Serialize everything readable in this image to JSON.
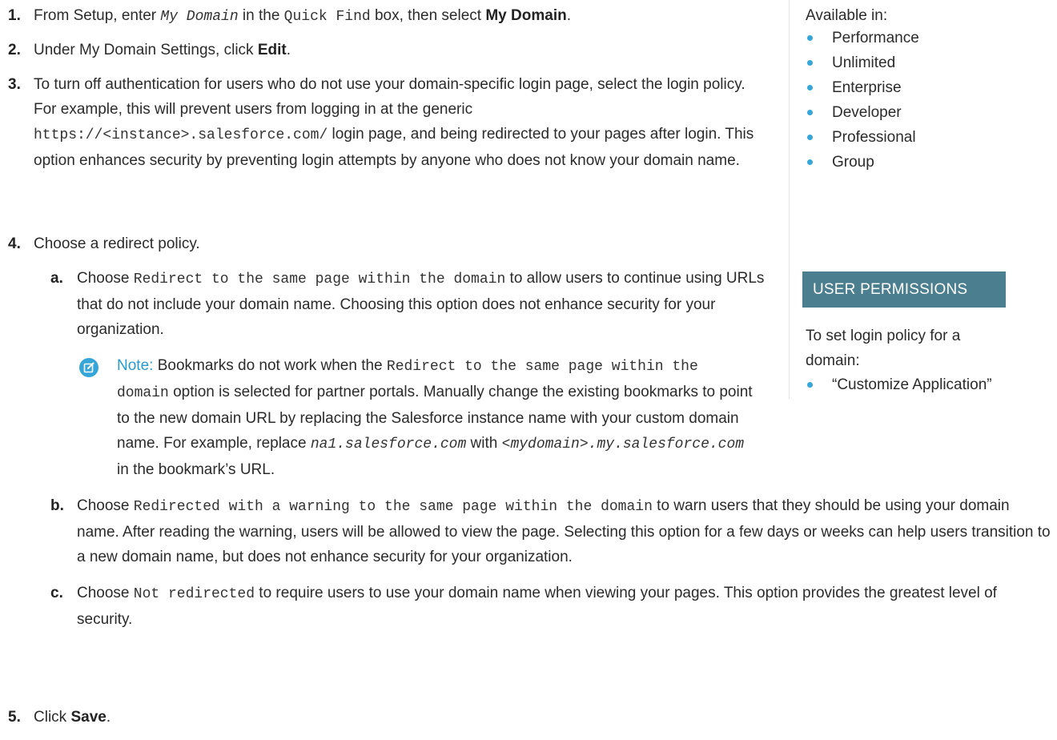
{
  "steps": {
    "s1": {
      "num": "1.",
      "t1": "From Setup, enter ",
      "code1": "My Domain",
      "t2": " in the ",
      "code2": "Quick Find",
      "t3": " box, then select ",
      "bold": "My Domain",
      "t4": "."
    },
    "s2": {
      "num": "2.",
      "t1": "Under My Domain Settings, click ",
      "bold": "Edit",
      "t2": "."
    },
    "s3": {
      "num": "3.",
      "t1": "To turn off authentication for users who do not use your domain-specific login page, select the login policy. For example, this will prevent users from logging in at the generic ",
      "code": "https://<instance>.salesforce.com/",
      "t2": " login page, and being redirected to your pages after login. This option enhances security by preventing login attempts by anyone who does not know your domain name."
    },
    "s4": {
      "num": "4.",
      "text": "Choose a redirect policy."
    },
    "sa": {
      "num": "a.",
      "t1": "Choose ",
      "code": "Redirect to the same page within the domain",
      "t2": " to allow users to continue using URLs that do not include your domain name. Choosing this option does not enhance security for your organization."
    },
    "note": {
      "label": "Note:",
      "t1": " Bookmarks do not work when the ",
      "code1": "Redirect to the same page within the domain",
      "t2": " option is selected for partner portals. Manually change the existing bookmarks to point to the new domain URL by replacing the Salesforce instance name with your custom domain name. For example, replace ",
      "code2": "na1.salesforce.com",
      "t3": " with ",
      "code3": "<mydomain>.my.salesforce.com",
      "t4": " in the bookmark’s URL."
    },
    "sb": {
      "num": "b.",
      "t1": "Choose ",
      "code": "Redirected with a warning to the same page within the domain",
      "t2": " to warn users that they should be using your domain name. After reading the warning, users will be allowed to view the page. Selecting this option for a few days or weeks can help users transition to a new domain name, but does not enhance security for your organization."
    },
    "sc": {
      "num": "c.",
      "t1": "Choose ",
      "code": "Not redirected",
      "t2": " to require users to use your domain name when viewing your pages. This option provides the greatest level of security."
    },
    "s5": {
      "num": "5.",
      "t1": "Click ",
      "bold": "Save",
      "t2": "."
    }
  },
  "sidebar": {
    "available_heading": "Available in:",
    "editions": [
      "Performance",
      "Unlimited",
      "Enterprise",
      "Developer",
      "Professional",
      "Group"
    ],
    "permissions_header": "USER PERMISSIONS",
    "permissions_desc": "To set login policy for a domain:",
    "permissions": [
      "“Customize Application”"
    ]
  },
  "colors": {
    "accent": "#36a6d8",
    "header_bg": "#4b7e8e",
    "note_label": "#2a9bd1"
  },
  "icons": {
    "note": "note-edit-icon"
  }
}
